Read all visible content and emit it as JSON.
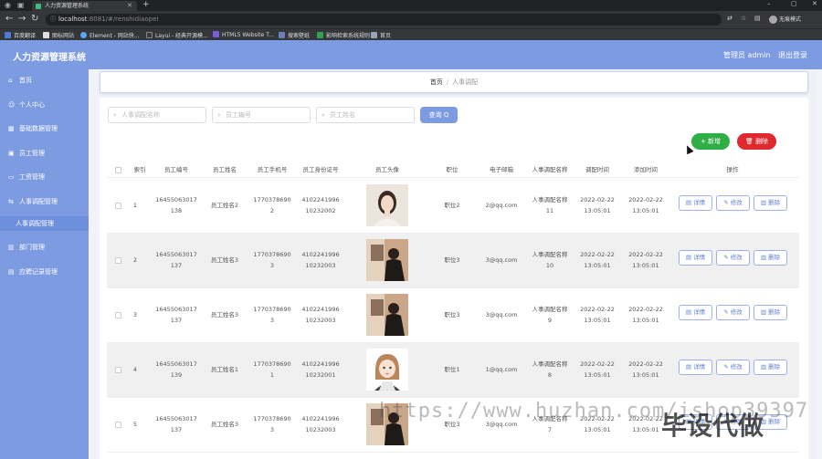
{
  "browser": {
    "tab_title": "人力资源管理系统",
    "url_host": "localhost",
    "url_rest": ":8081/#/renshidiaopei",
    "profile_label": "无痕模式",
    "bookmarks": [
      "百度翻译",
      "图标网站",
      "Element - 网站快...",
      "Layui - 经典开源模...",
      "HTML5 Website T...",
      "搜索壁纸",
      "影响检索系统规则",
      "首页"
    ]
  },
  "header": {
    "title": "人力资源管理系统",
    "admin_label": "管理员 admin",
    "logout_label": "退出登录"
  },
  "sidebar": {
    "items": [
      {
        "label": "首页",
        "icon": "home-icon"
      },
      {
        "label": "个人中心",
        "icon": "user-icon"
      },
      {
        "label": "基础数据管理",
        "icon": "grid-icon"
      },
      {
        "label": "员工管理",
        "icon": "users-icon"
      },
      {
        "label": "工资管理",
        "icon": "wallet-icon"
      },
      {
        "label": "人事调配管理",
        "icon": "swap-icon"
      }
    ],
    "sub_item": "人事调配管理",
    "items_after": [
      {
        "label": "部门管理",
        "icon": "building-icon"
      },
      {
        "label": "应聘记录管理",
        "icon": "file-icon"
      }
    ]
  },
  "breadcrumb": {
    "home": "首页",
    "separator": "/",
    "current": "人事调配"
  },
  "search": {
    "placeholder_1": "人事调配名称",
    "placeholder_2": "员工编号",
    "placeholder_3": "员工姓名",
    "query_label": "查询 Q"
  },
  "actions": {
    "add_label": "+ 新增",
    "delete_label": "删除"
  },
  "table": {
    "headers": [
      "索引",
      "员工编号",
      "员工姓名",
      "员工手机号",
      "员工身份证号",
      "员工头像",
      "职位",
      "电子邮箱",
      "人事调配名称",
      "调配时间",
      "添加时间",
      "操作"
    ],
    "rows": [
      {
        "index": "1",
        "emp_no": [
          "16455063017",
          "138"
        ],
        "name": "员工姓名2",
        "phone": [
          "1770378690",
          "2"
        ],
        "id_card": [
          "4102241996",
          "10232002"
        ],
        "avatar": "woman-portrait",
        "position": "职位2",
        "email": "2@qq.com",
        "transfer": [
          "人事调配名称",
          "11"
        ],
        "transfer_time": [
          "2022-02-22",
          "13:05:01"
        ],
        "add_time": [
          "2022-02-22",
          "13:05:01"
        ]
      },
      {
        "index": "2",
        "emp_no": [
          "16455063017",
          "137"
        ],
        "name": "员工姓名3",
        "phone": [
          "1770378690",
          "3"
        ],
        "id_card": [
          "4102241996",
          "10232003"
        ],
        "avatar": "man-photo",
        "position": "职位3",
        "email": "3@qq.com",
        "transfer": [
          "人事调配名称",
          "10"
        ],
        "transfer_time": [
          "2022-02-22",
          "13:05:01"
        ],
        "add_time": [
          "2022-02-22",
          "13:05:01"
        ]
      },
      {
        "index": "3",
        "emp_no": [
          "16455063017",
          "137"
        ],
        "name": "员工姓名3",
        "phone": [
          "1770378690",
          "3"
        ],
        "id_card": [
          "4102241996",
          "10232003"
        ],
        "avatar": "man-photo",
        "position": "职位3",
        "email": "3@qq.com",
        "transfer": [
          "人事调配名称",
          "9"
        ],
        "transfer_time": [
          "2022-02-22",
          "13:05:01"
        ],
        "add_time": [
          "2022-02-22",
          "13:05:01"
        ]
      },
      {
        "index": "4",
        "emp_no": [
          "16455063017",
          "139"
        ],
        "name": "员工姓名1",
        "phone": [
          "1770378690",
          "1"
        ],
        "id_card": [
          "4102241996",
          "10232001"
        ],
        "avatar": "cartoon-girl",
        "position": "职位1",
        "email": "1@qq.com",
        "transfer": [
          "人事调配名称",
          "8"
        ],
        "transfer_time": [
          "2022-02-22",
          "13:05:01"
        ],
        "add_time": [
          "2022-02-22",
          "13:05:01"
        ]
      },
      {
        "index": "5",
        "emp_no": [
          "16455063017",
          "137"
        ],
        "name": "员工姓名3",
        "phone": [
          "1770378690",
          "3"
        ],
        "id_card": [
          "4102241996",
          "10232003"
        ],
        "avatar": "man-photo",
        "position": "职位3",
        "email": "3@qq.com",
        "transfer": [
          "人事调配名称",
          "7"
        ],
        "transfer_time": [
          "2022-02-22",
          "13:05:01"
        ],
        "add_time": [
          "2022-02-22",
          "13:05:01"
        ]
      }
    ],
    "op_labels": {
      "detail": "详情",
      "edit": "修改",
      "delete": "删除"
    }
  },
  "watermark": {
    "url_text": "https://www.huzhan.com/ishop39397",
    "brand_text": "毕设代做"
  },
  "colors": {
    "sidebar": "#7c9be0",
    "accent": "#7c9be0",
    "add": "#2fae45",
    "delete": "#e0282f"
  }
}
